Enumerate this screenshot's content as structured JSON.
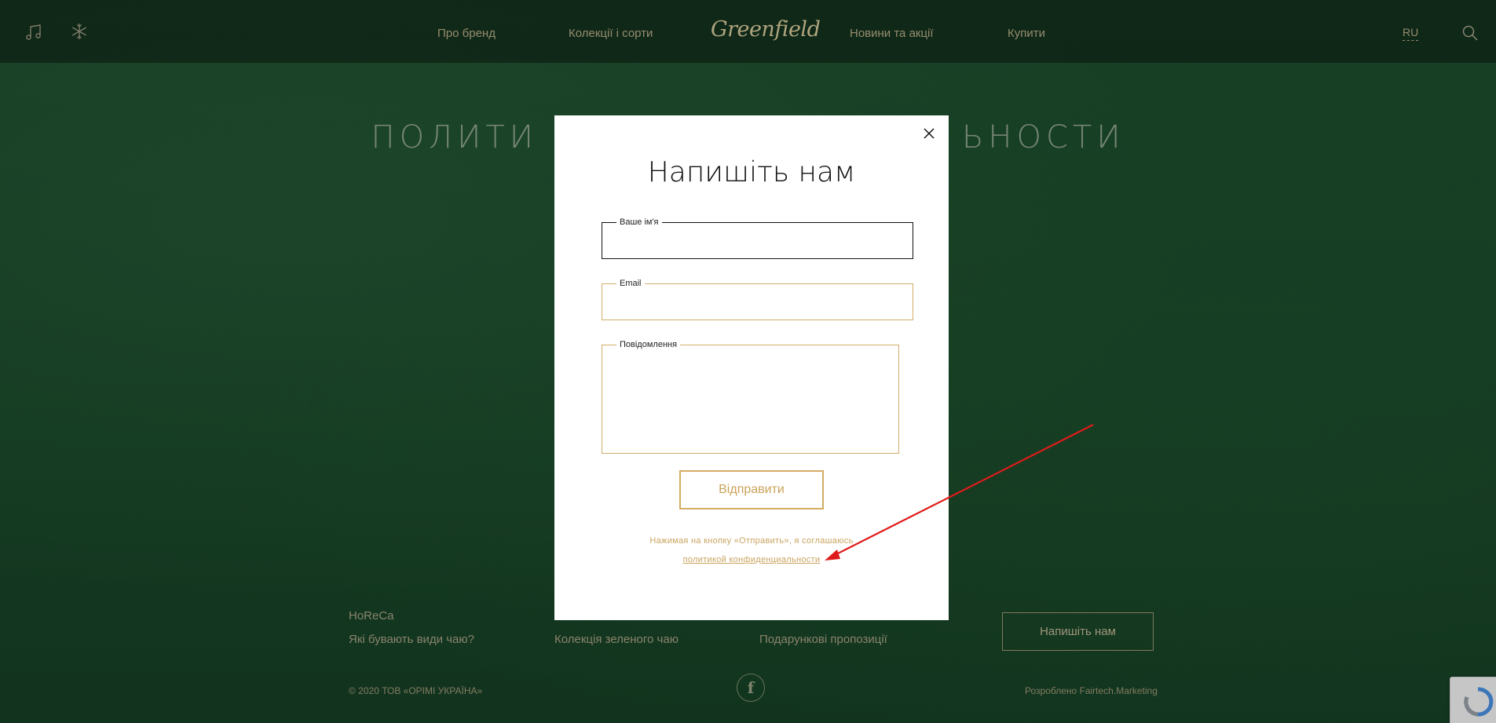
{
  "header": {
    "logo": "Greenfield",
    "nav": [
      {
        "label": "Про бренд"
      },
      {
        "label": "Колекції і сорти"
      },
      {
        "label": "Новини та акції"
      },
      {
        "label": "Купити"
      }
    ],
    "lang": "RU",
    "icons": [
      "music-icon",
      "snowflake-icon",
      "search-icon"
    ]
  },
  "page": {
    "heading_left": "ПОЛИТИ",
    "heading_right": "ЬНОСТИ"
  },
  "footer": {
    "col1": [
      "HoReCa",
      "Які бувають види чаю?"
    ],
    "col2": [
      "Колекція зеленого чаю"
    ],
    "col3": [
      "Подарункові пропозиції"
    ],
    "write_button": "Напишіть нам",
    "copyright": "© 2020 ТОВ «ОРІМІ УКРАЇНА»",
    "developer": "Розроблено Fairtech.Marketing",
    "social": "f"
  },
  "modal": {
    "title": "Напишіть нам",
    "fields": {
      "name_label": "Ваше ім'я",
      "name_value": "",
      "email_label": "Email",
      "email_value": "",
      "message_label": "Повідомлення",
      "message_value": ""
    },
    "submit_label": "Відправити",
    "consent_text": "Нажимая на  кнопку «Отправить», я  соглашаюсь",
    "consent_link": "политикой конфиденциальности"
  },
  "colors": {
    "accent_gold": "#d4ad63",
    "background_green": "#1b4a2b",
    "annotation_red": "#e01b1b"
  }
}
